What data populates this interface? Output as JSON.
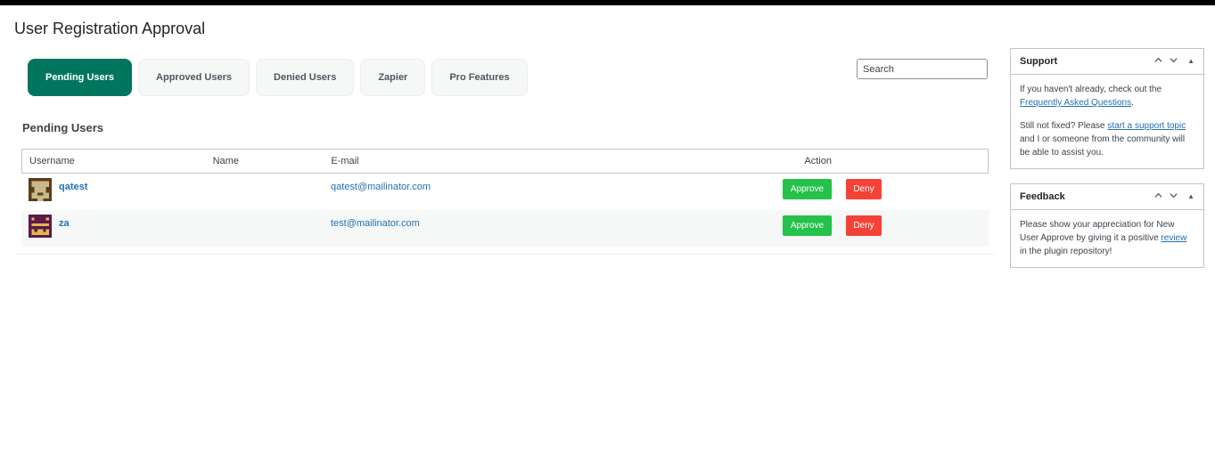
{
  "page": {
    "title": "User Registration Approval"
  },
  "tabs": [
    {
      "label": "Pending Users",
      "active": true
    },
    {
      "label": "Approved Users",
      "active": false
    },
    {
      "label": "Denied Users",
      "active": false
    },
    {
      "label": "Zapier",
      "active": false
    },
    {
      "label": "Pro Features",
      "active": false
    }
  ],
  "search": {
    "placeholder": "Search",
    "value": ""
  },
  "section": {
    "title": "Pending Users"
  },
  "table": {
    "headers": {
      "username": "Username",
      "name": "Name",
      "email": "E-mail",
      "action": "Action"
    },
    "rows": [
      {
        "username": "qatest",
        "name": "",
        "email": "qatest@mailinator.com",
        "approve": "Approve",
        "deny": "Deny"
      },
      {
        "username": "za",
        "name": "",
        "email": "test@mailinator.com",
        "approve": "Approve",
        "deny": "Deny"
      }
    ]
  },
  "support": {
    "title": "Support",
    "p1_text": "If you haven't already, check out the ",
    "p1_link": "Frequently Asked Questions",
    "p1_end": ".",
    "p2_text": "Still not fixed? Please ",
    "p2_link": "start a support topic",
    "p2_end": " and I or someone from the community will be able to assist you."
  },
  "feedback": {
    "title": "Feedback",
    "text": "Please show your appreciation for New User Approve by giving it a positive ",
    "link": "review",
    "end": " in the plugin repository!"
  },
  "colors": {
    "accent": "#01765f",
    "approve": "#24c14b",
    "deny": "#f44336",
    "link": "#2271b1"
  },
  "icons": {
    "collapse_up": "▲",
    "chevron_up": "chevron-up-icon",
    "chevron_down": "chevron-down-icon"
  }
}
